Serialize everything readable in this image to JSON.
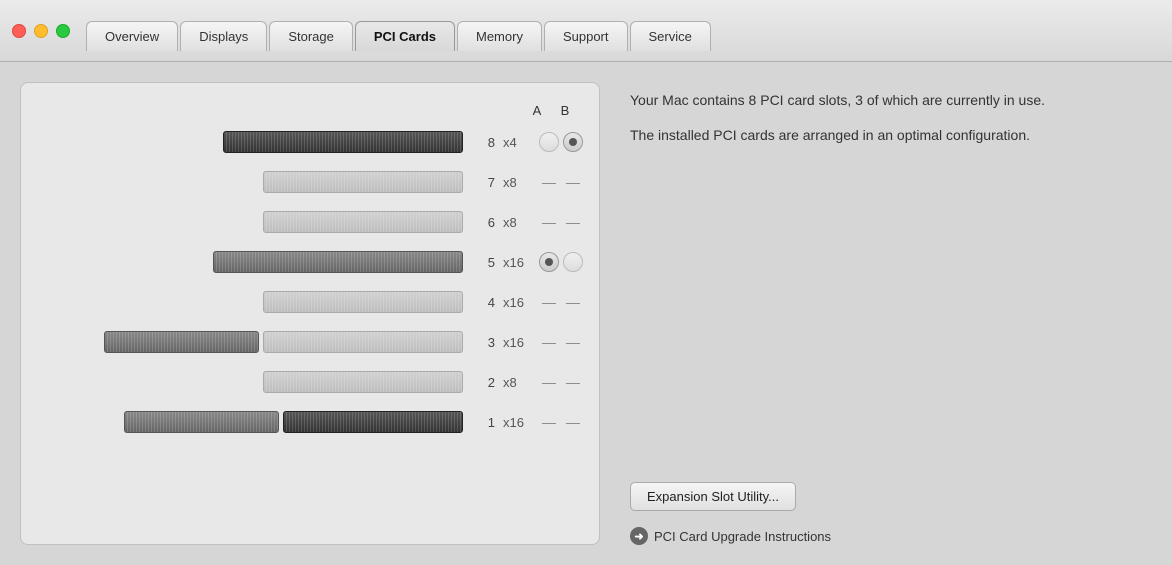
{
  "titlebar": {
    "controls": {
      "close_label": "",
      "minimize_label": "",
      "maximize_label": ""
    },
    "tabs": [
      {
        "id": "overview",
        "label": "Overview",
        "active": false
      },
      {
        "id": "displays",
        "label": "Displays",
        "active": false
      },
      {
        "id": "storage",
        "label": "Storage",
        "active": false
      },
      {
        "id": "pci-cards",
        "label": "PCI Cards",
        "active": true
      },
      {
        "id": "memory",
        "label": "Memory",
        "active": false
      },
      {
        "id": "support",
        "label": "Support",
        "active": false
      },
      {
        "id": "service",
        "label": "Service",
        "active": false
      }
    ]
  },
  "left_panel": {
    "col_a": "A",
    "col_b": "B",
    "slots": [
      {
        "num": "8",
        "speed": "x4",
        "bar1_style": "dark",
        "bar1_width": 240,
        "bar2_style": null,
        "col_a": "radio_empty",
        "col_b": "radio_filled"
      },
      {
        "num": "7",
        "speed": "x8",
        "bar1_style": null,
        "bar1_width": 0,
        "bar2_style": "inactive",
        "bar2_width": 200,
        "col_a": "dash",
        "col_b": "dash"
      },
      {
        "num": "6",
        "speed": "x8",
        "bar1_style": null,
        "bar1_width": 0,
        "bar2_style": "inactive",
        "bar2_width": 200,
        "col_a": "dash",
        "col_b": "dash"
      },
      {
        "num": "5",
        "speed": "x16",
        "bar1_style": "medium",
        "bar1_width": 250,
        "bar2_style": null,
        "col_a": "radio_filled",
        "col_b": "radio_empty"
      },
      {
        "num": "4",
        "speed": "x16",
        "bar1_style": null,
        "bar1_width": 0,
        "bar2_style": "inactive",
        "bar2_width": 200,
        "col_a": "dash",
        "col_b": "dash"
      },
      {
        "num": "3",
        "speed": "x16",
        "bar1_style": "medium2",
        "bar1_width": 155,
        "bar2_style": "inactive",
        "bar2_width": 200,
        "col_a": "dash",
        "col_b": "dash"
      },
      {
        "num": "2",
        "speed": "x8",
        "bar1_style": null,
        "bar1_width": 0,
        "bar2_style": "inactive",
        "bar2_width": 200,
        "col_a": "dash",
        "col_b": "dash"
      },
      {
        "num": "1",
        "speed": "x16",
        "bar1_style": "medium2",
        "bar1_width": 155,
        "bar2_style": "dark2",
        "bar2_width": 180,
        "col_a": "dash",
        "col_b": "dash"
      }
    ]
  },
  "right_panel": {
    "description_1": "Your Mac contains 8 PCI card slots, 3 of which are currently in use.",
    "description_2": "The installed PCI cards are arranged in an optimal configuration.",
    "expansion_btn_label": "Expansion Slot Utility...",
    "pci_link_label": "PCI Card Upgrade Instructions",
    "pci_link_icon": "➜"
  }
}
